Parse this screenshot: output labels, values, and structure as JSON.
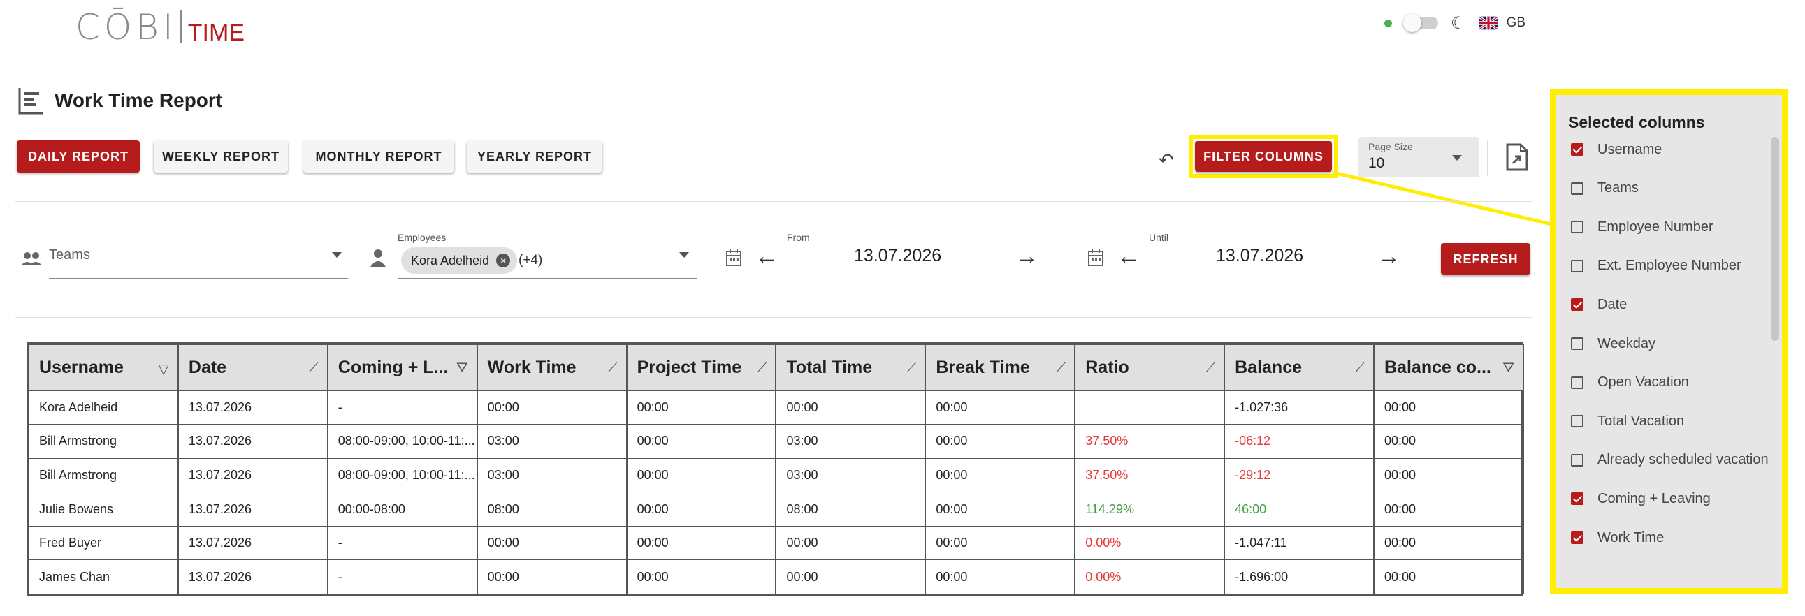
{
  "app": {
    "logo_main": "CŌBI",
    "logo_sub": "TIME",
    "lang": "GB",
    "accent": "#b71c1c"
  },
  "page": {
    "title": "Work Time Report"
  },
  "reports": {
    "daily": "DAILY REPORT",
    "weekly": "WEEKLY REPORT",
    "monthly": "MONTHLY REPORT",
    "yearly": "YEARLY REPORT"
  },
  "toolbar": {
    "filter_columns": "FILTER COLUMNS",
    "page_size_label": "Page Size",
    "page_size_value": "10",
    "refresh": "REFRESH"
  },
  "filters": {
    "teams_placeholder": "Teams",
    "employees_label": "Employees",
    "employee_chip": "Kora Adelheid",
    "employee_more": "(+4)",
    "from_label": "From",
    "from_value": "13.07.2026",
    "until_label": "Until",
    "until_value": "13.07.2026"
  },
  "table": {
    "headers": [
      "Username",
      "Date",
      "Coming + L...",
      "Work Time",
      "Project Time",
      "Total Time",
      "Break Time",
      "Ratio",
      "Balance",
      "Balance co..."
    ],
    "rows": [
      [
        "Kora Adelheid",
        "13.07.2026",
        "-",
        "00:00",
        "00:00",
        "00:00",
        "00:00",
        "",
        "-1.027:36",
        "00:00"
      ],
      [
        "Bill Armstrong",
        "13.07.2026",
        "08:00-09:00, 10:00-11:...",
        "03:00",
        "00:00",
        "03:00",
        "00:00",
        "37.50%",
        "-06:12",
        "00:00"
      ],
      [
        "Bill Armstrong",
        "13.07.2026",
        "08:00-09:00, 10:00-11:...",
        "03:00",
        "00:00",
        "03:00",
        "00:00",
        "37.50%",
        "-29:12",
        "00:00"
      ],
      [
        "Julie Bowens",
        "13.07.2026",
        "00:00-08:00",
        "08:00",
        "00:00",
        "08:00",
        "00:00",
        "114.29%",
        "46:00",
        "00:00"
      ],
      [
        "Fred Buyer",
        "13.07.2026",
        "-",
        "00:00",
        "00:00",
        "00:00",
        "00:00",
        "0.00%",
        "-1.047:11",
        "00:00"
      ],
      [
        "James Chan",
        "13.07.2026",
        "-",
        "00:00",
        "00:00",
        "00:00",
        "00:00",
        "0.00%",
        "-1.696:00",
        "00:00"
      ]
    ]
  },
  "panel": {
    "title": "Selected columns",
    "items": [
      {
        "label": "Username",
        "checked": true
      },
      {
        "label": "Teams",
        "checked": false
      },
      {
        "label": "Employee Number",
        "checked": false
      },
      {
        "label": "Ext. Employee Number",
        "checked": false
      },
      {
        "label": "Date",
        "checked": true
      },
      {
        "label": "Weekday",
        "checked": false
      },
      {
        "label": "Open Vacation",
        "checked": false
      },
      {
        "label": "Total Vacation",
        "checked": false
      },
      {
        "label": "Already scheduled vacation",
        "checked": false
      },
      {
        "label": "Coming + Leaving",
        "checked": true
      },
      {
        "label": "Work Time",
        "checked": true
      }
    ]
  }
}
